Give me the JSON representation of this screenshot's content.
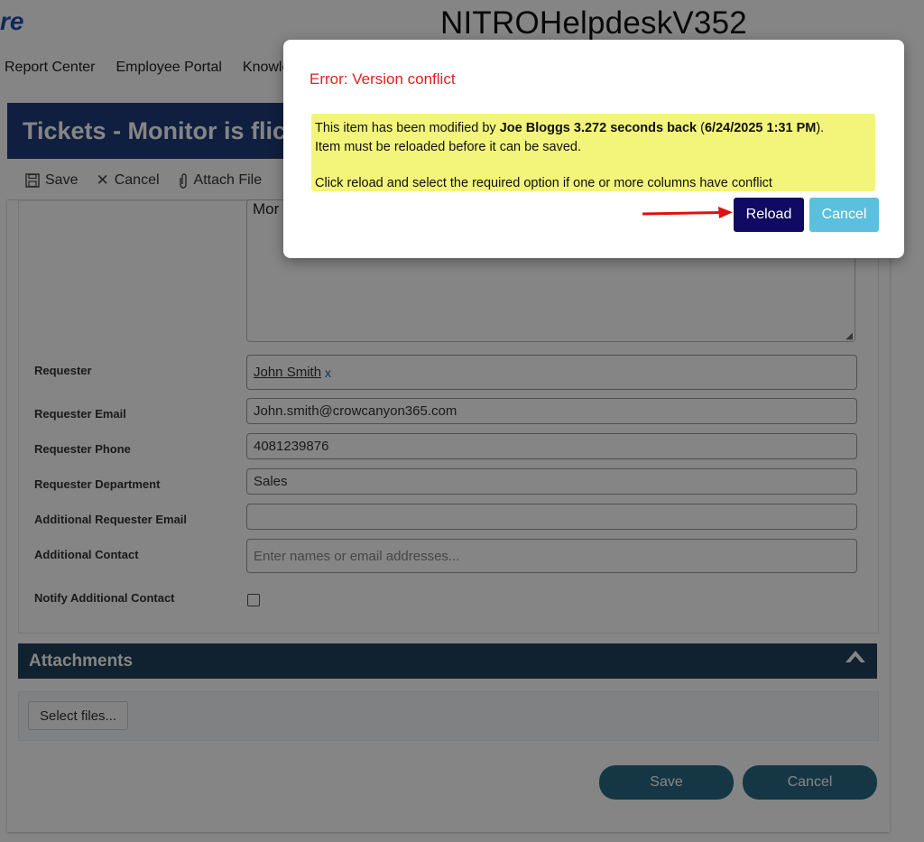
{
  "header": {
    "brand_fragment": "re",
    "site_title": "NITROHelpdeskV352",
    "nav": [
      "Report Center",
      "Employee Portal",
      "Knowle"
    ]
  },
  "ticket": {
    "title": "Tickets - Monitor is flic",
    "toolbar": {
      "save": "Save",
      "cancel": "Cancel",
      "attach": "Attach File"
    },
    "description_partial": "Mor"
  },
  "form": {
    "requester": {
      "label": "Requester",
      "value": "John Smith",
      "remove": "x"
    },
    "requester_email": {
      "label": "Requester Email",
      "value": "John.smith@crowcanyon365.com"
    },
    "requester_phone": {
      "label": "Requester Phone",
      "value": "4081239876"
    },
    "requester_department": {
      "label": "Requester Department",
      "value": "Sales"
    },
    "additional_requester_email": {
      "label": "Additional Requester Email",
      "value": ""
    },
    "additional_contact": {
      "label": "Additional Contact",
      "placeholder": "Enter names or email addresses..."
    },
    "notify_additional_contact": {
      "label": "Notify Additional Contact",
      "checked": false
    }
  },
  "attachments": {
    "title": "Attachments",
    "select_files": "Select files..."
  },
  "footer": {
    "save": "Save",
    "cancel": "Cancel"
  },
  "dialog": {
    "title": "Error: Version conflict",
    "msg_prefix": "This item has been modified by ",
    "msg_bold": "Joe Bloggs 3.272 seconds back",
    "msg_open": " (",
    "msg_bold2": "6/24/2025 1:31 PM",
    "msg_close": ").",
    "line2": "Item must be reloaded before it can be saved.",
    "line3": "Click reload and select the required option if one or more columns have conflict",
    "reload": "Reload",
    "cancel": "Cancel"
  },
  "colors": {
    "header_bg": "#1f3d7a",
    "attach_header_bg": "#20405a",
    "error_text": "#e02020",
    "notice_bg": "#f3f57a",
    "reload_bg": "#100a63",
    "cancel_bg": "#5bc0de",
    "arrow": "#e01010"
  }
}
